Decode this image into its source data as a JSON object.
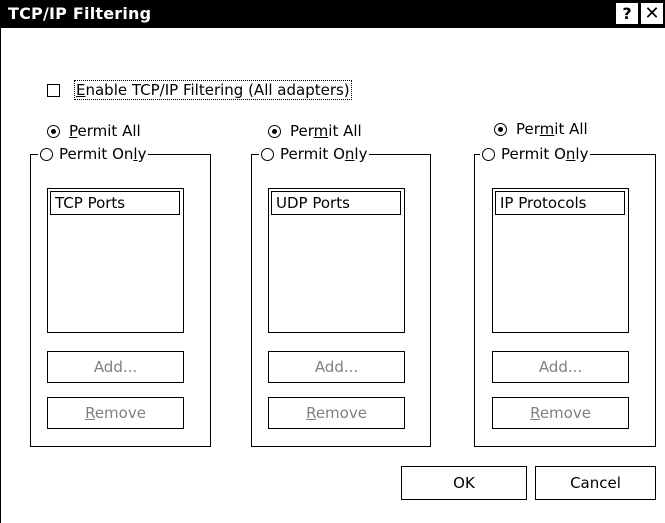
{
  "window": {
    "title": "TCP/IP Filtering",
    "help_glyph": "?",
    "close_glyph": "✕"
  },
  "enable": {
    "first_letter": "E",
    "rest": "nable TCP/IP Filtering (All adapters)",
    "checked": false
  },
  "groups": [
    {
      "permit_all": {
        "pre": "",
        "key": "P",
        "post": "ermit All",
        "selected": true
      },
      "permit_only": {
        "pre": "Permit On",
        "key": "l",
        "post": "y",
        "selected": false
      },
      "list_header": "TCP Ports",
      "add_label": "Add...",
      "remove": {
        "key": "R",
        "post": "emove"
      }
    },
    {
      "permit_all": {
        "pre": "Per",
        "key": "m",
        "post": "it All",
        "selected": true
      },
      "permit_only": {
        "pre": "Permit O",
        "key": "n",
        "post": "ly",
        "selected": false
      },
      "list_header": "UDP Ports",
      "add_label": "Add...",
      "remove": {
        "key": "R",
        "post": "emove"
      }
    },
    {
      "permit_all": {
        "pre": "Per",
        "key": "m",
        "post": "it All",
        "selected": true
      },
      "permit_only": {
        "pre": "Permit O",
        "key": "n",
        "post": "ly",
        "selected": false
      },
      "list_header": "IP Protocols",
      "add_label": "Add...",
      "remove": {
        "key": "R",
        "post": "emove"
      }
    }
  ],
  "buttons": {
    "ok": "OK",
    "cancel": "Cancel"
  }
}
